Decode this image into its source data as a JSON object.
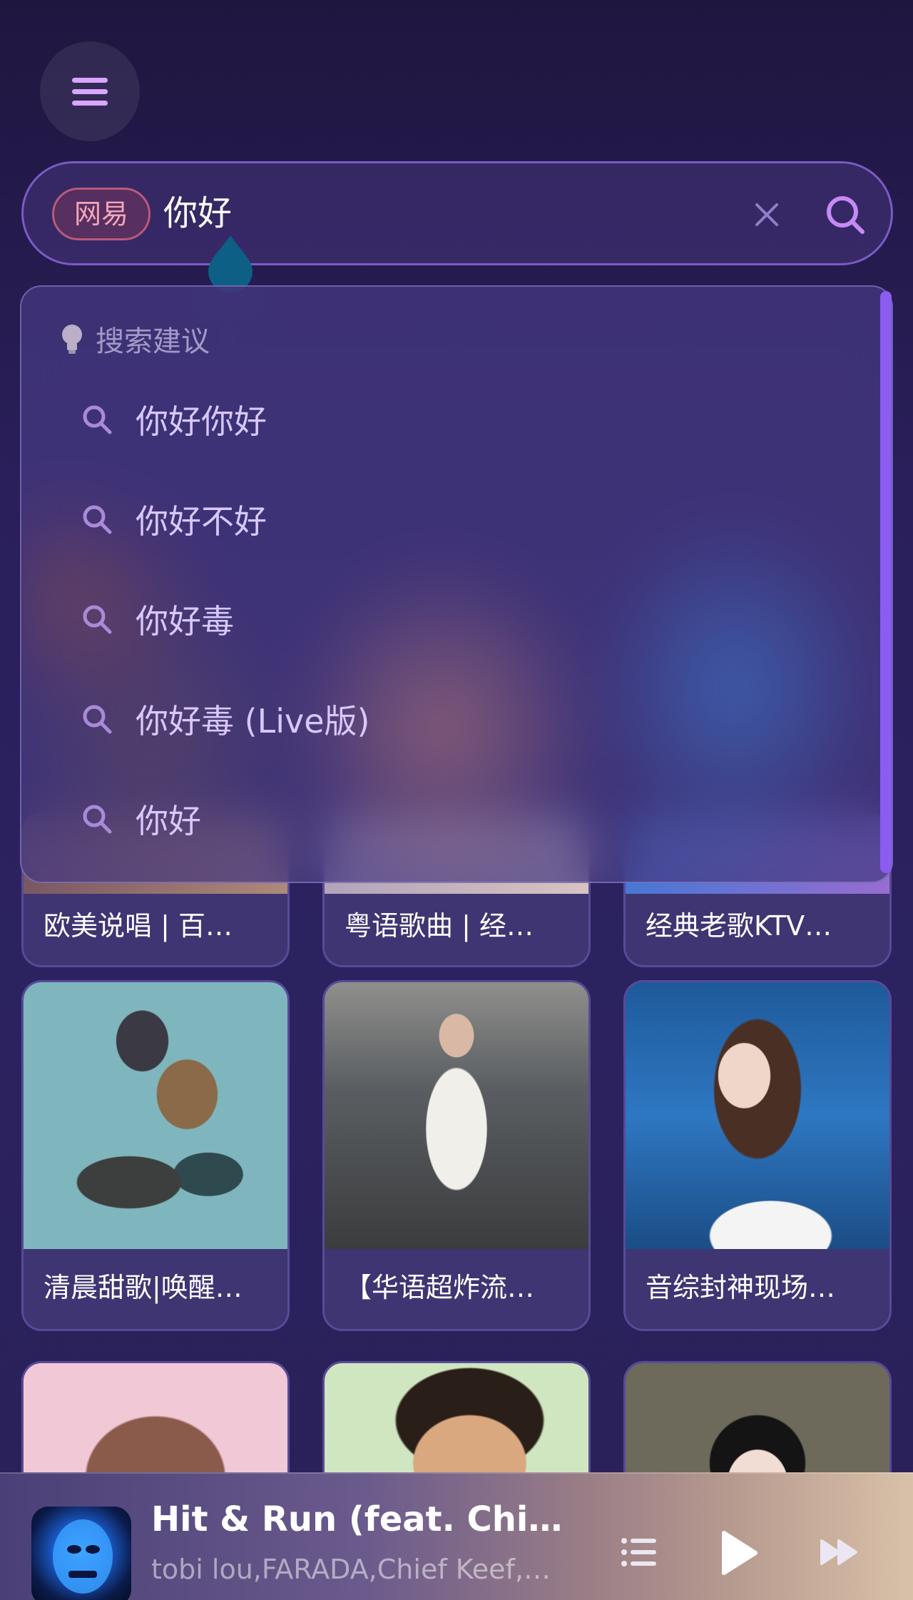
{
  "header": {
    "menu_icon": "hamburger-menu-icon"
  },
  "search": {
    "source_tag": "网易",
    "query": "你好",
    "clear_icon": "close-icon",
    "submit_icon": "search-icon"
  },
  "suggestions": {
    "header_icon": "lightbulb-icon",
    "header": "搜索建议",
    "items": [
      {
        "label": "你好你好"
      },
      {
        "label": "你好不好"
      },
      {
        "label": "你好毒"
      },
      {
        "label": "你好毒 (Live版)"
      },
      {
        "label": "你好"
      }
    ]
  },
  "playlists": {
    "row1": [
      {
        "title": "欧美说唱 | 百…"
      },
      {
        "title": "粤语歌曲 | 经…"
      },
      {
        "title": "经典老歌KTV…"
      }
    ],
    "row2": [
      {
        "title": "清晨甜歌|唤醒…"
      },
      {
        "title": "【华语超炸流…"
      },
      {
        "title": "音综封神现场…"
      }
    ]
  },
  "player": {
    "title": "Hit & Run (feat. Chief K…",
    "artist": "tobi lou,FARADA,Chief Keef,…",
    "playlist_icon": "playlist-icon",
    "play_icon": "play-icon",
    "next_icon": "fast-forward-icon"
  },
  "colors": {
    "accent": "#d9a6ff",
    "source_tag": "#f2a5b8",
    "scrollbar": "#8a5cf0"
  }
}
